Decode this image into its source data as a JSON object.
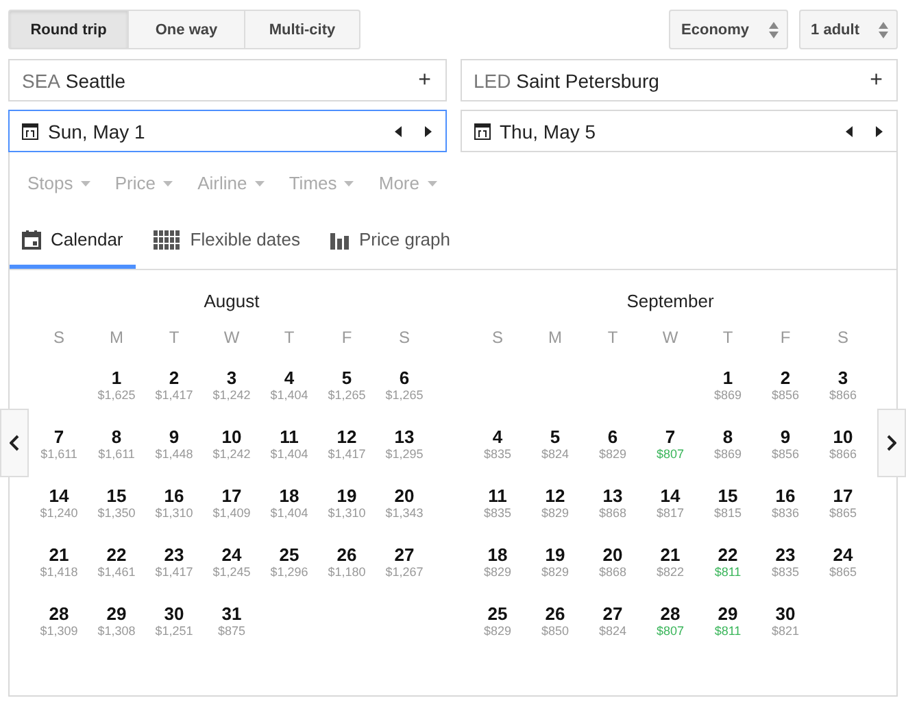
{
  "trip_types": [
    {
      "label": "Round trip",
      "selected": true
    },
    {
      "label": "One way",
      "selected": false
    },
    {
      "label": "Multi-city",
      "selected": false
    }
  ],
  "cabin": "Economy",
  "passengers": "1 adult",
  "origin": {
    "code": "SEA",
    "city": "Seattle",
    "action": "+"
  },
  "destination": {
    "code": "LED",
    "city": "Saint Petersburg",
    "action": "+"
  },
  "departure": {
    "value": "Sun, May 1",
    "focused": true
  },
  "return": {
    "value": "Thu, May 5",
    "focused": false
  },
  "filters": [
    "Stops",
    "Price",
    "Airline",
    "Times",
    "More"
  ],
  "views": [
    {
      "label": "Calendar",
      "kind": "calendar",
      "selected": true
    },
    {
      "label": "Flexible dates",
      "kind": "grid",
      "selected": false
    },
    {
      "label": "Price graph",
      "kind": "bars",
      "selected": false
    }
  ],
  "months": [
    {
      "name": "August",
      "weekdays": [
        "S",
        "M",
        "T",
        "W",
        "T",
        "F",
        "S"
      ],
      "weeks": [
        [
          {
            "day": "1",
            "price": "$1,625",
            "cheapest": false
          },
          {
            "day": "2",
            "price": "$1,417",
            "cheapest": false
          },
          {
            "day": "3",
            "price": "$1,242",
            "cheapest": false
          },
          {
            "day": "4",
            "price": "$1,404",
            "cheapest": false
          },
          {
            "day": "5",
            "price": "$1,265",
            "cheapest": false
          },
          {
            "day": "6",
            "price": "$1,265",
            "cheapest": false
          }
        ],
        [
          {
            "day": "7",
            "price": "$1,611",
            "cheapest": false
          },
          {
            "day": "8",
            "price": "$1,611",
            "cheapest": false
          },
          {
            "day": "9",
            "price": "$1,448",
            "cheapest": false
          },
          {
            "day": "10",
            "price": "$1,242",
            "cheapest": false
          },
          {
            "day": "11",
            "price": "$1,404",
            "cheapest": false
          },
          {
            "day": "12",
            "price": "$1,417",
            "cheapest": false
          },
          {
            "day": "13",
            "price": "$1,295",
            "cheapest": false
          }
        ],
        [
          {
            "day": "14",
            "price": "$1,240",
            "cheapest": false
          },
          {
            "day": "15",
            "price": "$1,350",
            "cheapest": false
          },
          {
            "day": "16",
            "price": "$1,310",
            "cheapest": false
          },
          {
            "day": "17",
            "price": "$1,409",
            "cheapest": false
          },
          {
            "day": "18",
            "price": "$1,404",
            "cheapest": false
          },
          {
            "day": "19",
            "price": "$1,310",
            "cheapest": false
          },
          {
            "day": "20",
            "price": "$1,343",
            "cheapest": false
          }
        ],
        [
          {
            "day": "21",
            "price": "$1,418",
            "cheapest": false
          },
          {
            "day": "22",
            "price": "$1,461",
            "cheapest": false
          },
          {
            "day": "23",
            "price": "$1,417",
            "cheapest": false
          },
          {
            "day": "24",
            "price": "$1,245",
            "cheapest": false
          },
          {
            "day": "25",
            "price": "$1,296",
            "cheapest": false
          },
          {
            "day": "26",
            "price": "$1,180",
            "cheapest": false
          },
          {
            "day": "27",
            "price": "$1,267",
            "cheapest": false
          }
        ],
        [
          {
            "day": "28",
            "price": "$1,309",
            "cheapest": false
          },
          {
            "day": "29",
            "price": "$1,308",
            "cheapest": false
          },
          {
            "day": "30",
            "price": "$1,251",
            "cheapest": false
          },
          {
            "day": "31",
            "price": "$875",
            "cheapest": false
          }
        ]
      ]
    },
    {
      "name": "September",
      "weekdays": [
        "S",
        "M",
        "T",
        "W",
        "T",
        "F",
        "S"
      ],
      "weeks": [
        [
          {
            "day": "1",
            "price": "$869",
            "cheapest": false
          },
          {
            "day": "2",
            "price": "$856",
            "cheapest": false
          },
          {
            "day": "3",
            "price": "$866",
            "cheapest": false
          }
        ],
        [
          {
            "day": "4",
            "price": "$835",
            "cheapest": false
          },
          {
            "day": "5",
            "price": "$824",
            "cheapest": false
          },
          {
            "day": "6",
            "price": "$829",
            "cheapest": false
          },
          {
            "day": "7",
            "price": "$807",
            "cheapest": true
          },
          {
            "day": "8",
            "price": "$869",
            "cheapest": false
          },
          {
            "day": "9",
            "price": "$856",
            "cheapest": false
          },
          {
            "day": "10",
            "price": "$866",
            "cheapest": false
          }
        ],
        [
          {
            "day": "11",
            "price": "$835",
            "cheapest": false
          },
          {
            "day": "12",
            "price": "$829",
            "cheapest": false
          },
          {
            "day": "13",
            "price": "$868",
            "cheapest": false
          },
          {
            "day": "14",
            "price": "$817",
            "cheapest": false
          },
          {
            "day": "15",
            "price": "$815",
            "cheapest": false
          },
          {
            "day": "16",
            "price": "$836",
            "cheapest": false
          },
          {
            "day": "17",
            "price": "$865",
            "cheapest": false
          }
        ],
        [
          {
            "day": "18",
            "price": "$829",
            "cheapest": false
          },
          {
            "day": "19",
            "price": "$829",
            "cheapest": false
          },
          {
            "day": "20",
            "price": "$868",
            "cheapest": false
          },
          {
            "day": "21",
            "price": "$822",
            "cheapest": false
          },
          {
            "day": "22",
            "price": "$811",
            "cheapest": true
          },
          {
            "day": "23",
            "price": "$835",
            "cheapest": false
          },
          {
            "day": "24",
            "price": "$865",
            "cheapest": false
          }
        ],
        [
          {
            "day": "25",
            "price": "$829",
            "cheapest": false
          },
          {
            "day": "26",
            "price": "$850",
            "cheapest": false
          },
          {
            "day": "27",
            "price": "$824",
            "cheapest": false
          },
          {
            "day": "28",
            "price": "$807",
            "cheapest": true
          },
          {
            "day": "29",
            "price": "$811",
            "cheapest": true
          },
          {
            "day": "30",
            "price": "$821",
            "cheapest": false
          }
        ]
      ]
    }
  ]
}
